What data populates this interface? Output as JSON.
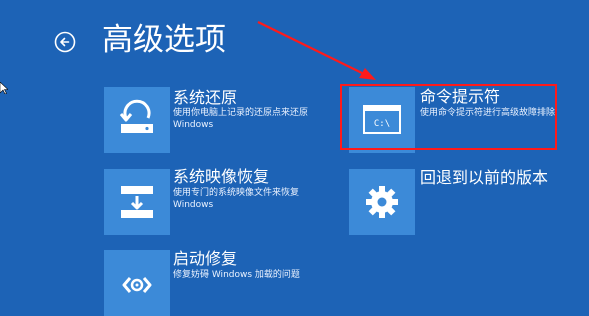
{
  "page": {
    "title": "高级选项",
    "back_icon": "back-arrow-circle-icon"
  },
  "options": [
    {
      "id": "system-restore",
      "title": "系统还原",
      "description_line1": "使用你电脑上记录的还原点来还原",
      "description_line2": "Windows",
      "icon": "system-restore-icon"
    },
    {
      "id": "command-prompt",
      "title": "命令提示符",
      "description_line1": "使用命令提示符进行高级故障排除",
      "description_line2": "",
      "icon": "command-prompt-icon"
    },
    {
      "id": "system-image-recovery",
      "title": "系统映像恢复",
      "description_line1": "使用专门的系统映像文件来恢复",
      "description_line2": "Windows",
      "icon": "system-image-recovery-icon"
    },
    {
      "id": "go-back-previous-version",
      "title": "回退到以前的版本",
      "description_line1": "",
      "description_line2": "",
      "icon": "gear-icon"
    },
    {
      "id": "startup-repair",
      "title": "启动修复",
      "description_line1": "修复妨碍 Windows 加载的问题",
      "description_line2": "",
      "icon": "startup-repair-icon"
    }
  ],
  "command_prompt_icon_text": "C:\\",
  "colors": {
    "background": "#1d63b6",
    "tile": "#3c8ad8",
    "highlight": "#ff1a1a",
    "text": "#ffffff"
  }
}
